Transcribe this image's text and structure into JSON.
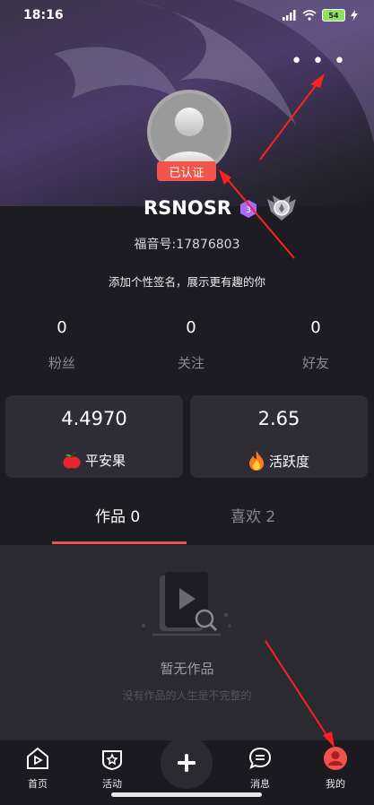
{
  "status_bar": {
    "time": "18:16",
    "battery": "54"
  },
  "profile": {
    "verified_label": "已认证",
    "username": "RSNOSR",
    "vip_level": "3",
    "fuyin_id": "福音号:17876803",
    "signature": "添加个性签名，展示更有趣的你"
  },
  "stats": [
    {
      "value": "0",
      "label": "粉丝"
    },
    {
      "value": "0",
      "label": "关注"
    },
    {
      "value": "0",
      "label": "好友"
    }
  ],
  "cards": [
    {
      "value": "4.4970",
      "label": "平安果",
      "icon": "apple-icon"
    },
    {
      "value": "2.65",
      "label": "活跃度",
      "icon": "flame-icon"
    }
  ],
  "tabs": [
    {
      "label": "作品 0",
      "active": true
    },
    {
      "label": "喜欢 2",
      "active": false
    }
  ],
  "empty": {
    "title": "暂无作品",
    "subtitle": "没有作品的人生是不完整的"
  },
  "bottom_nav": [
    {
      "label": "首页",
      "icon": "home-icon"
    },
    {
      "label": "活动",
      "icon": "activity-icon"
    },
    {
      "label": "",
      "icon": "plus-icon"
    },
    {
      "label": "消息",
      "icon": "message-icon"
    },
    {
      "label": "我的",
      "icon": "profile-icon"
    }
  ],
  "colors": {
    "accent": "#f0544a",
    "background": "#1d1c22",
    "card": "#2e2d35",
    "annotation": "#ff2020"
  }
}
